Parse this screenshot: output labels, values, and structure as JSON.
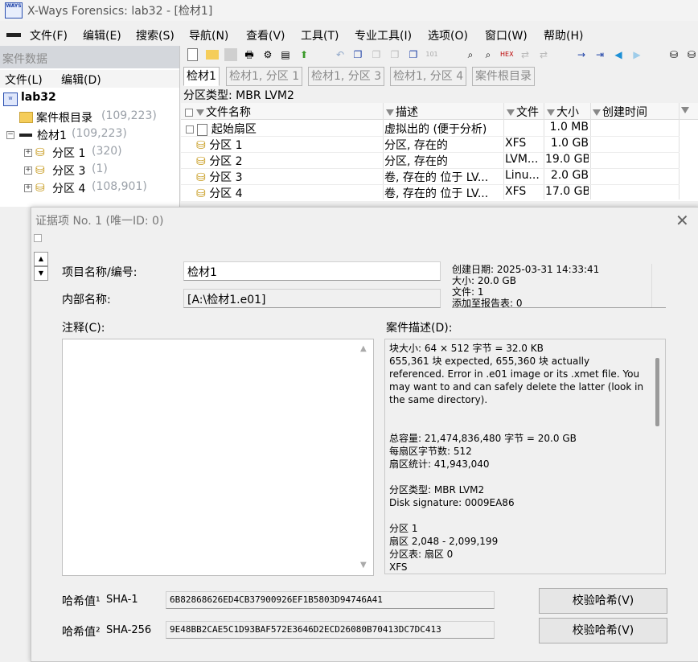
{
  "window": {
    "title": "X-Ways Forensics: lab32 - [检材1]",
    "logo_text": "WAYS"
  },
  "menu": [
    "文件(F)",
    "编辑(E)",
    "搜索(S)",
    "导航(N)",
    "查看(V)",
    "工具(T)",
    "专业工具(I)",
    "选项(O)",
    "窗口(W)",
    "帮助(H)"
  ],
  "left_panel": {
    "header": "案件数据",
    "menu": [
      "文件(L)",
      "编辑(D)"
    ],
    "tree": {
      "case": "lab32",
      "root_dir": {
        "label": "案件根目录",
        "count": "(109,223)"
      },
      "evidence": {
        "label": "检材1",
        "count": "(109,223)"
      },
      "partitions": [
        {
          "label": "分区 1",
          "count": "(320)"
        },
        {
          "label": "分区 3",
          "count": "(1)"
        },
        {
          "label": "分区 4",
          "count": "(108,901)"
        }
      ]
    }
  },
  "tabs": [
    "检材1",
    "检材1, 分区 1",
    "检材1, 分区 3",
    "检材1, 分区 4",
    "案件根目录"
  ],
  "partition_type_line": "分区类型: MBR LVM2",
  "table": {
    "columns": [
      "文件名称",
      "描述",
      "文件",
      "大小",
      "创建时间"
    ],
    "rows": [
      {
        "name": "起始扇区",
        "desc": "虚拟出的 (便于分析)",
        "type": "",
        "size": "1.0 MB"
      },
      {
        "name": "分区 1",
        "desc": "分区, 存在的",
        "type": "XFS",
        "size": "1.0 GB"
      },
      {
        "name": "分区 2",
        "desc": "分区, 存在的",
        "type": "LVM...",
        "size": "19.0 GB"
      },
      {
        "name": "分区 3",
        "desc": "卷, 存在的 位于 LV...",
        "type": "Linu...",
        "size": "2.0 GB"
      },
      {
        "name": "分区 4",
        "desc": "卷, 存在的 位于 LV...",
        "type": "XFS",
        "size": "17.0 GB"
      }
    ]
  },
  "dialog": {
    "title": "证据项 No. 1 (唯一ID: 0)",
    "item_name_label": "项目名称/编号:",
    "item_name_value": "检材1",
    "internal_name_label": "内部名称:",
    "internal_name_value": "[A:\\检材1.e01]",
    "info_lines": [
      "创建日期: 2025-03-31  14:33:41",
      "大小: 20.0 GB",
      "文件: 1",
      "添加至报告表: 0"
    ],
    "notes_label": "注释(C):",
    "case_desc_label": "案件描述(D):",
    "case_desc_lines": [
      "块大小: 64 × 512 字节 = 32.0 KB",
      "655,361 块 expected, 655,360 块 actually referenced. Error in .e01 image or its .xmet file. You may want to and can safely delete the latter (look in the same directory).",
      "",
      "总容量: 21,474,836,480 字节 = 20.0 GB",
      "每扇区字节数: 512",
      "扇区统计: 41,943,040",
      "",
      "分区类型: MBR LVM2",
      "Disk signature: 0009EA86",
      "",
      "分区 1",
      "扇区 2,048 - 2,099,199",
      "分区表: 扇区 0",
      "XFS"
    ],
    "hash1_label": "哈希值¹",
    "hash1_algo": "SHA-1",
    "hash1_value": "6B82868626ED4CB37900926EF1B5803D94746A41",
    "hash2_label": "哈希值²",
    "hash2_algo": "SHA-256",
    "hash2_value": "9E48BB2CAE5C1D93BAF572E3646D2ECD26080B70413DC7DC413",
    "verify_label": "校验哈希(V)"
  }
}
